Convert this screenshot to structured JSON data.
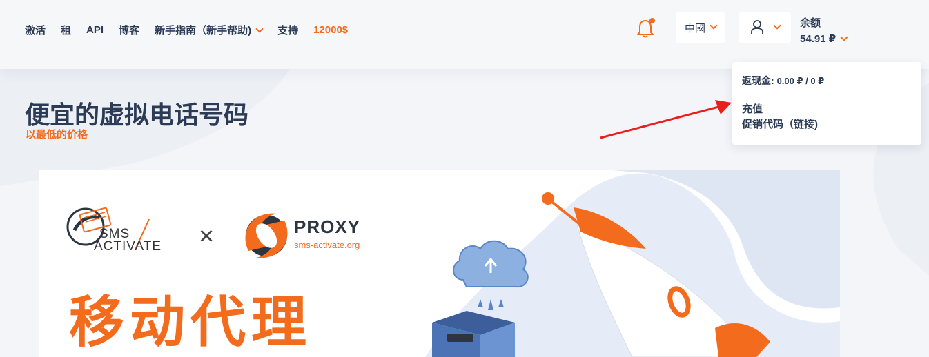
{
  "nav": {
    "items": [
      {
        "label": "激活"
      },
      {
        "label": "租"
      },
      {
        "label": "API"
      },
      {
        "label": "博客"
      },
      {
        "label": "新手指南（新手帮助)"
      },
      {
        "label": "支持"
      },
      {
        "label": "12000$"
      }
    ]
  },
  "header": {
    "language": "中國",
    "balance_label": "余额",
    "balance_value": "54.91 ₽",
    "notification_icon": "bell-icon",
    "user_icon": "user-icon"
  },
  "balance_dropdown": {
    "cashback_label": "返现金",
    "cashback_value": "0.00 ₽ / 0 ₽",
    "topup": "充值",
    "promo": "促销代码（链接)"
  },
  "hero": {
    "title": "便宜的虚拟电话号码",
    "subtitle": "以最低的价格"
  },
  "banner": {
    "sms_logo_line1": "SMS",
    "sms_logo_line2": "ACTIVATE",
    "times": "×",
    "proxy_title": "PROXY",
    "proxy_subtitle": "sms-activate.org",
    "big_title": "移动代理"
  },
  "colors": {
    "accent": "#f36b1c",
    "text": "#2b3a55",
    "annotation_arrow": "#e8201c"
  }
}
